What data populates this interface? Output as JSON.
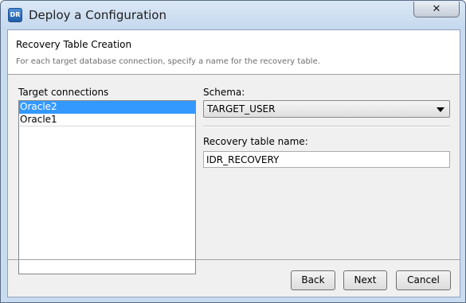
{
  "window": {
    "title": "Deploy a Configuration",
    "icon_text": "DR",
    "close_label": "✕"
  },
  "header": {
    "title": "Recovery Table Creation",
    "description": "For each target database connection, specify a name for the recovery table."
  },
  "connections": {
    "label": "Target connections",
    "items": [
      {
        "label": "Oracle2",
        "selected": true
      },
      {
        "label": "Oracle1",
        "selected": false
      }
    ]
  },
  "schema": {
    "label": "Schema:",
    "value": "TARGET_USER"
  },
  "recovery_table": {
    "label": "Recovery table name:",
    "value": "IDR_RECOVERY"
  },
  "buttons": {
    "back": "Back",
    "next": "Next",
    "cancel": "Cancel"
  }
}
